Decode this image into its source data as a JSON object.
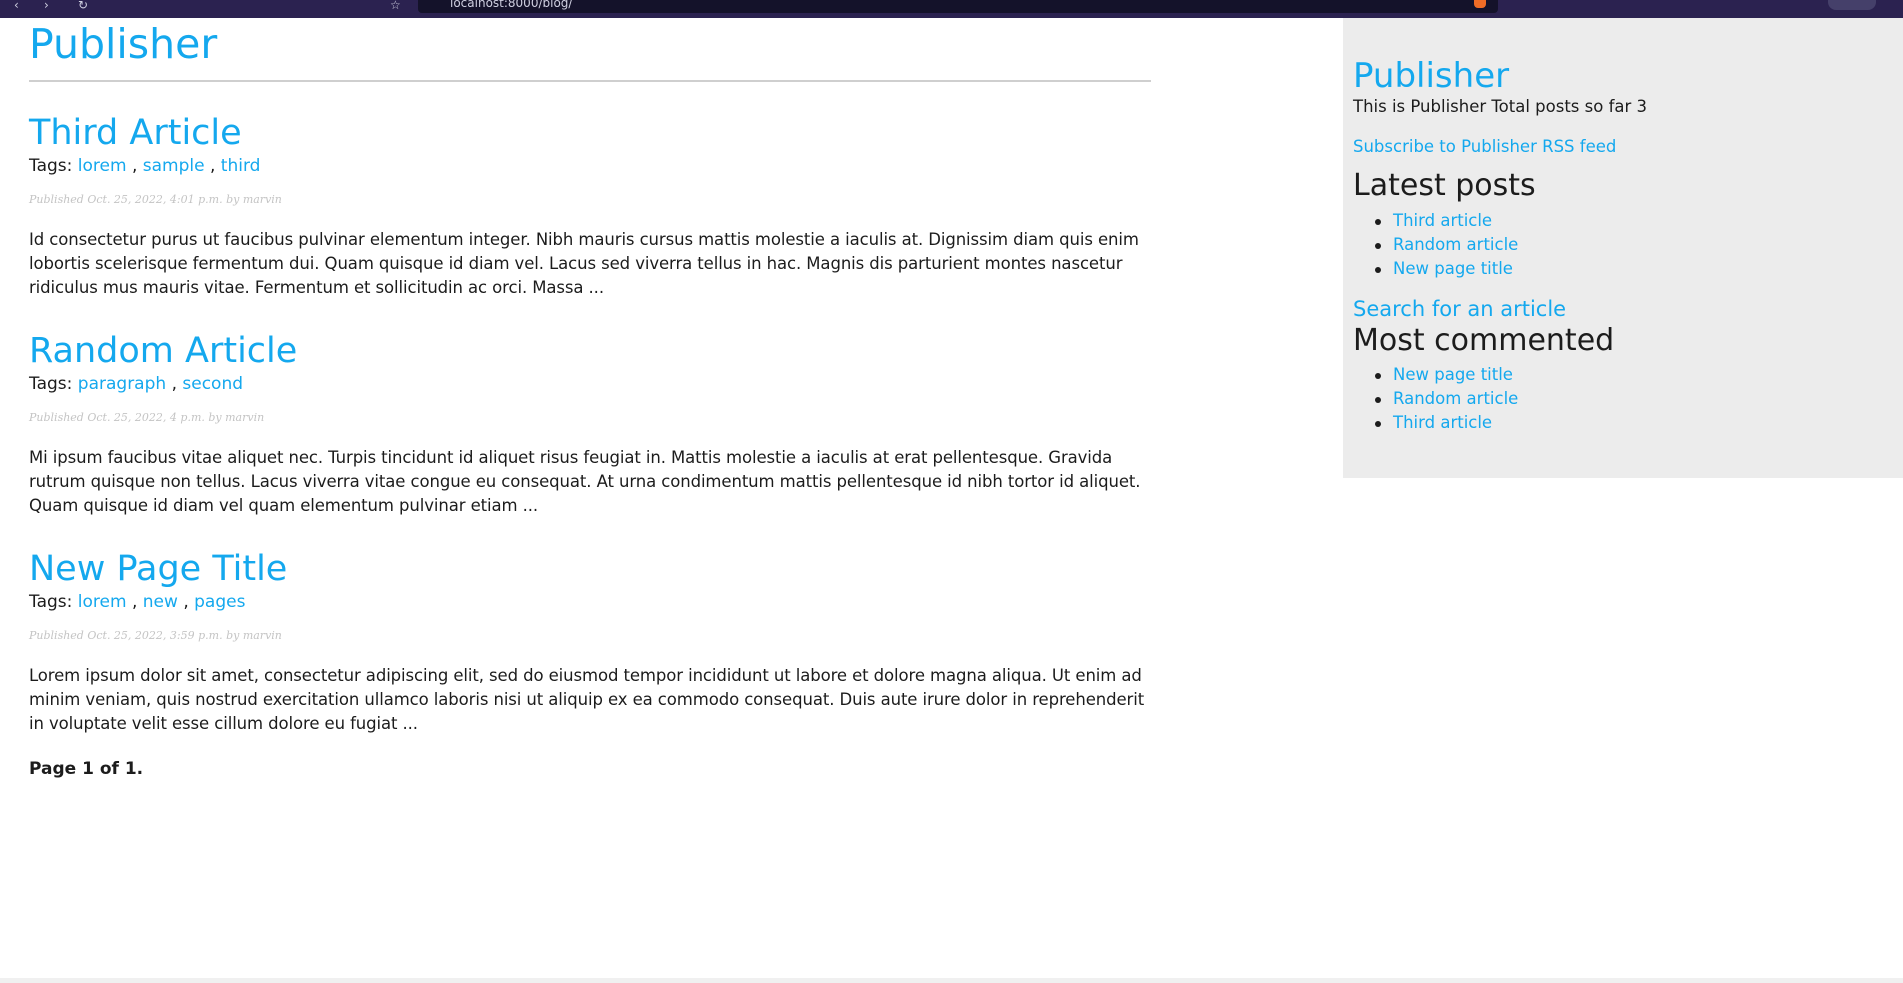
{
  "browser": {
    "url": "localhost:8000/blog/"
  },
  "site": {
    "title": "Publisher"
  },
  "articles": [
    {
      "title": "Third Article",
      "tags_label": "Tags:",
      "tags": [
        "lorem",
        "sample",
        "third"
      ],
      "meta": "Published Oct. 25, 2022, 4:01 p.m. by marvin",
      "excerpt": "Id consectetur purus ut faucibus pulvinar elementum integer. Nibh mauris cursus mattis molestie a iaculis at. Dignissim diam quis enim lobortis scelerisque fermentum dui. Quam quisque id diam vel. Lacus sed viverra tellus in hac. Magnis dis parturient montes nascetur ridiculus mus mauris vitae. Fermentum et sollicitudin ac orci. Massa ..."
    },
    {
      "title": "Random Article",
      "tags_label": "Tags:",
      "tags": [
        "paragraph",
        "second"
      ],
      "meta": "Published Oct. 25, 2022, 4 p.m. by marvin",
      "excerpt": "Mi ipsum faucibus vitae aliquet nec. Turpis tincidunt id aliquet risus feugiat in. Mattis molestie a iaculis at erat pellentesque. Gravida rutrum quisque non tellus. Lacus viverra vitae congue eu consequat. At urna condimentum mattis pellentesque id nibh tortor id aliquet. Quam quisque id diam vel quam elementum pulvinar etiam ..."
    },
    {
      "title": "New Page Title",
      "tags_label": "Tags:",
      "tags": [
        "lorem",
        "new",
        "pages"
      ],
      "meta": "Published Oct. 25, 2022, 3:59 p.m. by marvin",
      "excerpt": "Lorem ipsum dolor sit amet, consectetur adipiscing elit, sed do eiusmod tempor incididunt ut labore et dolore magna aliqua. Ut enim ad minim veniam, quis nostrud exercitation ullamco laboris nisi ut aliquip ex ea commodo consequat. Duis aute irure dolor in reprehenderit in voluptate velit esse cillum dolore eu fugiat ..."
    }
  ],
  "pagination": {
    "text": "Page 1 of 1."
  },
  "sidebar": {
    "title": "Publisher",
    "description": "This is Publisher Total posts so far 3",
    "rss_link": "Subscribe to Publisher RSS feed",
    "latest_heading": "Latest posts",
    "latest_posts": [
      "Third article",
      "Random article",
      "New page title"
    ],
    "search_link": "Search for an article",
    "most_commented_heading": "Most commented",
    "most_commented": [
      "New page title",
      "Random article",
      "Third article"
    ]
  },
  "colors": {
    "link": "#14a8ee",
    "sidebar_bg": "#ececec",
    "text": "#1c1c1c",
    "meta": "#c4c4c4",
    "browser_chrome": "#2b2250"
  }
}
